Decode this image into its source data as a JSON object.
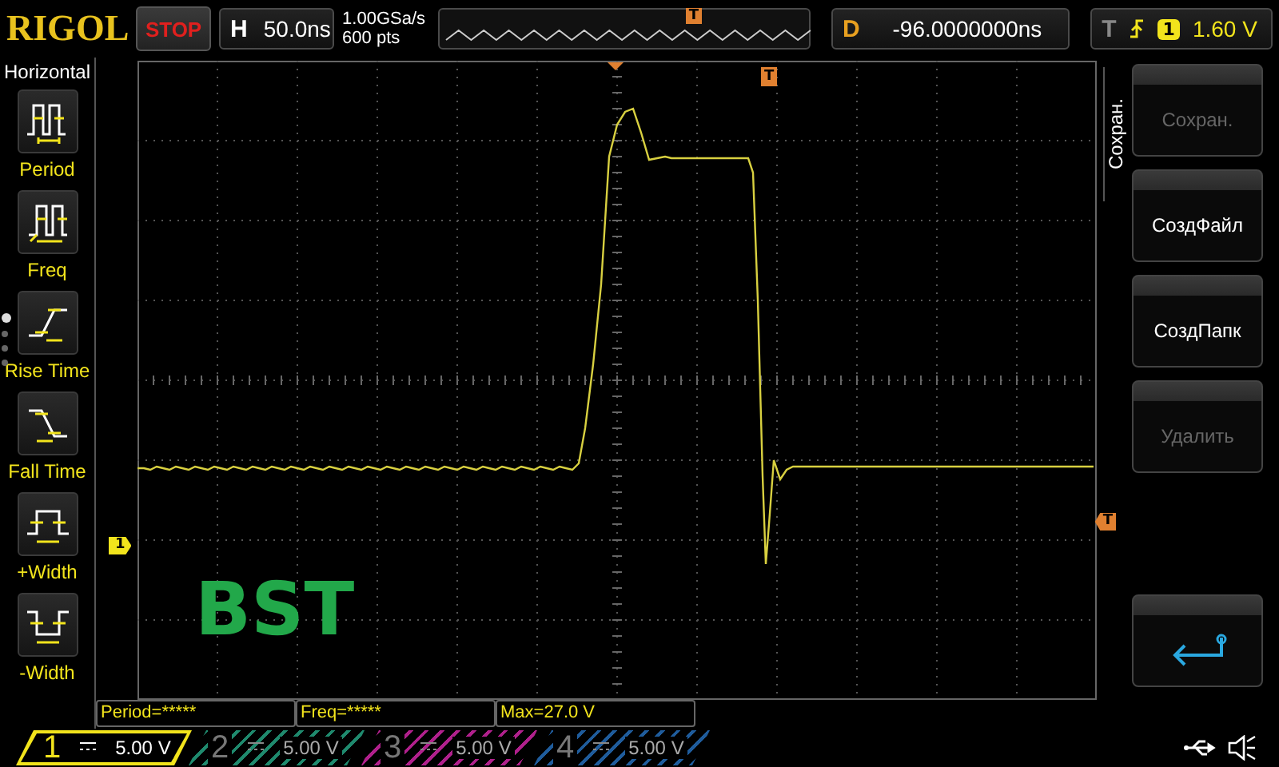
{
  "header": {
    "logo": "RIGOL",
    "run_state": "STOP",
    "timebase": {
      "label": "H",
      "value": "50.0ns"
    },
    "sample_rate": "1.00GSa/s",
    "memory_depth": "600 pts",
    "overview_marker": "T",
    "delay": {
      "label": "D",
      "value": "-96.0000000ns"
    },
    "trigger": {
      "label": "T",
      "channel": "1",
      "level": "1.60 V"
    }
  },
  "left_menu": {
    "title": "Horizontal",
    "items": [
      {
        "label": "Period",
        "kind": "period"
      },
      {
        "label": "Freq",
        "kind": "freq"
      },
      {
        "label": "Rise Time",
        "kind": "rise"
      },
      {
        "label": "Fall Time",
        "kind": "fall"
      },
      {
        "label": "+Width",
        "kind": "pwidth"
      },
      {
        "label": "-Width",
        "kind": "nwidth"
      }
    ],
    "pages": [
      {
        "selected": true
      },
      {
        "selected": false
      },
      {
        "selected": false
      },
      {
        "selected": false
      }
    ]
  },
  "scope": {
    "channel_marker": "1",
    "trigger_level_marker": "T",
    "trigger_position_marker": "T",
    "annotation": "BST"
  },
  "measurements": [
    "Period=*****",
    "Freq=*****",
    "Max=27.0 V"
  ],
  "right_menu": {
    "title": "Сохран.",
    "items": [
      {
        "kind": "text",
        "label": "Сохран.",
        "disabled": true
      },
      {
        "kind": "text",
        "label": "СоздФайл",
        "disabled": false
      },
      {
        "kind": "text",
        "label": "СоздПапк",
        "disabled": false
      },
      {
        "kind": "text",
        "label": "Удалить",
        "disabled": true
      },
      {
        "kind": "back"
      }
    ]
  },
  "channels": [
    {
      "number": "1",
      "scale": "5.00 V",
      "on": true,
      "color": "#f2e41c"
    },
    {
      "number": "2",
      "scale": "5.00 V",
      "on": false,
      "color": "#1f8a6e"
    },
    {
      "number": "3",
      "scale": "5.00 V",
      "on": false,
      "color": "#b0208c"
    },
    {
      "number": "4",
      "scale": "5.00 V",
      "on": false,
      "color": "#1f5c9c"
    }
  ]
}
